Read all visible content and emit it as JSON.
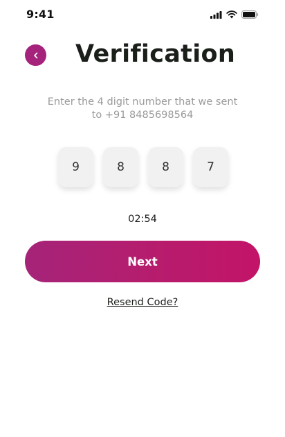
{
  "status_bar": {
    "time": "9:41",
    "icons": [
      "signal-icon",
      "wifi-icon",
      "battery-icon"
    ]
  },
  "header": {
    "back_icon": "chevron-left-icon",
    "title": "Verification"
  },
  "instruction": {
    "line1": "Enter the 4 digit number that we sent",
    "line2": "to +91 8485698564"
  },
  "otp": {
    "digits": [
      "9",
      "8",
      "8",
      "7"
    ]
  },
  "timer": "02:54",
  "next_button": {
    "label": "Next"
  },
  "resend": {
    "label": "Resend Code?"
  },
  "colors": {
    "accent": "#a5237b",
    "gradient_start": "#a52479",
    "gradient_end": "#c31468",
    "otp_box_bg": "#f1f1f1",
    "instruction_text": "#9a9a9a"
  }
}
